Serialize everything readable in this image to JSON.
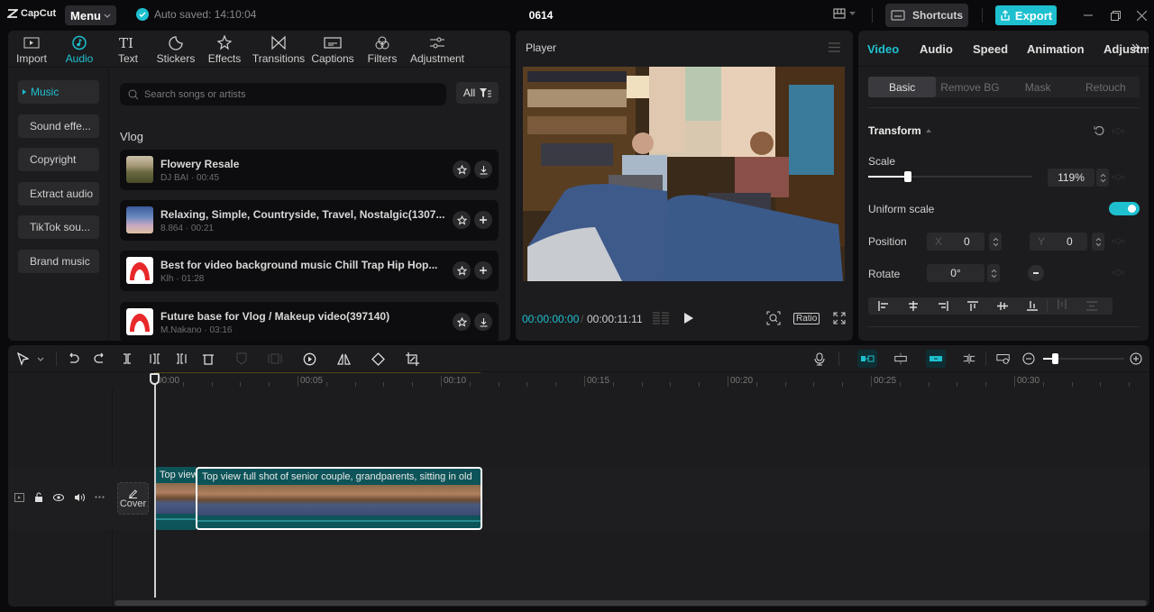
{
  "app": {
    "name": "CapCut",
    "menu_label": "Menu",
    "autosave_text": "Auto saved: 14:10:04",
    "project_title": "0614",
    "shortcuts_label": "Shortcuts",
    "export_label": "Export",
    "accent_color": "#1ec0d0"
  },
  "toolbar_tabs": [
    {
      "label": "Import",
      "icon": "import-icon"
    },
    {
      "label": "Audio",
      "icon": "audio-icon",
      "active": true
    },
    {
      "label": "Text",
      "icon": "text-icon"
    },
    {
      "label": "Stickers",
      "icon": "stickers-icon"
    },
    {
      "label": "Effects",
      "icon": "effects-icon"
    },
    {
      "label": "Transitions",
      "icon": "transitions-icon"
    },
    {
      "label": "Captions",
      "icon": "captions-icon"
    },
    {
      "label": "Filters",
      "icon": "filters-icon"
    },
    {
      "label": "Adjustment",
      "icon": "adjustment-icon"
    }
  ],
  "audio_nav": [
    {
      "label": "Music",
      "active": true
    },
    {
      "label": "Sound effe..."
    },
    {
      "label": "Copyright"
    },
    {
      "label": "Extract audio"
    },
    {
      "label": "TikTok sou..."
    },
    {
      "label": "Brand music"
    }
  ],
  "search": {
    "placeholder": "Search songs or artists",
    "value": ""
  },
  "filter_label": "All",
  "section_title": "Vlog",
  "tracks": [
    {
      "title": "Flowery Resale",
      "subtitle": "DJ BAI · 00:45",
      "action": "download"
    },
    {
      "title": "Relaxing, Simple, Countryside, Travel, Nostalgic(1307...",
      "subtitle": "8.864 · 00:21",
      "action": "add"
    },
    {
      "title": "Best for video background music Chill Trap Hip Hop...",
      "subtitle": "Klh · 01:28",
      "action": "add"
    },
    {
      "title": "Future base for Vlog / Makeup video(397140)",
      "subtitle": "M.Nakano · 03:16",
      "action": "download"
    }
  ],
  "player": {
    "title": "Player",
    "current_time": "00:00:00:00",
    "separator": "/",
    "duration": "00:00:11:11",
    "ratio_label": "Ratio"
  },
  "props": {
    "tabs": [
      "Video",
      "Audio",
      "Speed",
      "Animation",
      "Adjustm"
    ],
    "active_tab": "Video",
    "subtabs": [
      "Basic",
      "Remove BG",
      "Mask",
      "Retouch"
    ],
    "active_subtab": "Basic",
    "section": "Transform",
    "scale_label": "Scale",
    "scale_value": "119%",
    "scale_fraction": 0.24,
    "uniform_scale_label": "Uniform scale",
    "uniform_scale_on": true,
    "position_label": "Position",
    "x_label": "X",
    "x_value": "0",
    "y_label": "Y",
    "y_value": "0",
    "rotate_label": "Rotate",
    "rotate_value": "0°"
  },
  "timeline": {
    "ruler_labels": [
      "00:00",
      "00:05",
      "00:10",
      "00:15",
      "00:20",
      "00:25",
      "00:30"
    ],
    "cover_label": "Cover",
    "clips": [
      {
        "caption": "Top view full shot of senior couple, grandparents, sitting in old"
      },
      {
        "caption": "Top view full shot of senior couple, grandparents, sitting in old"
      }
    ]
  }
}
